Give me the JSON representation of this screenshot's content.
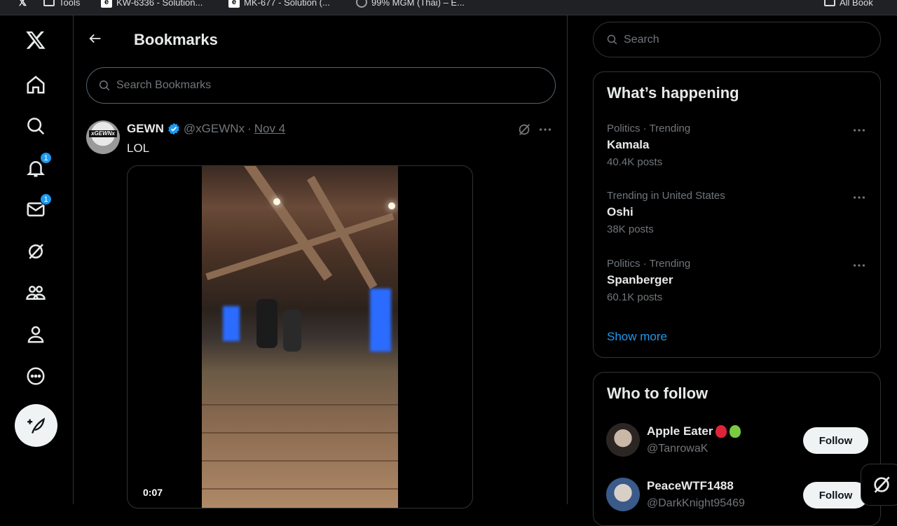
{
  "browser": {
    "bookmarks": [
      {
        "label": "",
        "icon": "x-favicon"
      },
      {
        "label": "Tools",
        "icon": "folder-icon"
      },
      {
        "label": "KW-6336 - Solution...",
        "icon": "e-favicon"
      },
      {
        "label": "MK-677 - Solution (...",
        "icon": "e-favicon"
      },
      {
        "label": "99% MGM (Thai) – E...",
        "icon": "globe-icon"
      },
      {
        "label": "All Book",
        "icon": "folder-icon"
      }
    ]
  },
  "nav": {
    "items": [
      {
        "name": "x-logo",
        "badge": ""
      },
      {
        "name": "home-icon",
        "badge": ""
      },
      {
        "name": "explore-icon",
        "badge": ""
      },
      {
        "name": "notifications-icon",
        "badge": "1"
      },
      {
        "name": "messages-icon",
        "badge": "1"
      },
      {
        "name": "grok-icon",
        "badge": ""
      },
      {
        "name": "communities-icon",
        "badge": ""
      },
      {
        "name": "profile-icon",
        "badge": ""
      },
      {
        "name": "more-icon",
        "badge": ""
      }
    ]
  },
  "header": {
    "title": "Bookmarks",
    "search_placeholder": "Search Bookmarks"
  },
  "tweet": {
    "author_name": "GEWN",
    "avatar_text": "xGEWNx",
    "handle": "@xGEWNx",
    "separator": "·",
    "date": "Nov 4",
    "text": "LOL",
    "video_time": "0:07"
  },
  "sidebar": {
    "search_placeholder": "Search",
    "trends_title": "What’s happening",
    "trends": [
      {
        "meta": "Politics · Trending",
        "name": "Kamala",
        "count": "40.4K posts"
      },
      {
        "meta": "Trending in United States",
        "name": "Oshi",
        "count": "38K posts"
      },
      {
        "meta": "Politics · Trending",
        "name": "Spanberger",
        "count": "60.1K posts"
      }
    ],
    "show_more": "Show more",
    "follow_title": "Who to follow",
    "follow": [
      {
        "name": "Apple Eater",
        "handle": "@TanrowaK",
        "button": "Follow"
      },
      {
        "name": "PeaceWTF1488",
        "handle": "@DarkKnight95469",
        "button": "Follow"
      }
    ]
  },
  "colors": {
    "accent": "#1d9bf0",
    "background": "#000000",
    "border": "#2f3336",
    "muted_text": "#71767b"
  }
}
